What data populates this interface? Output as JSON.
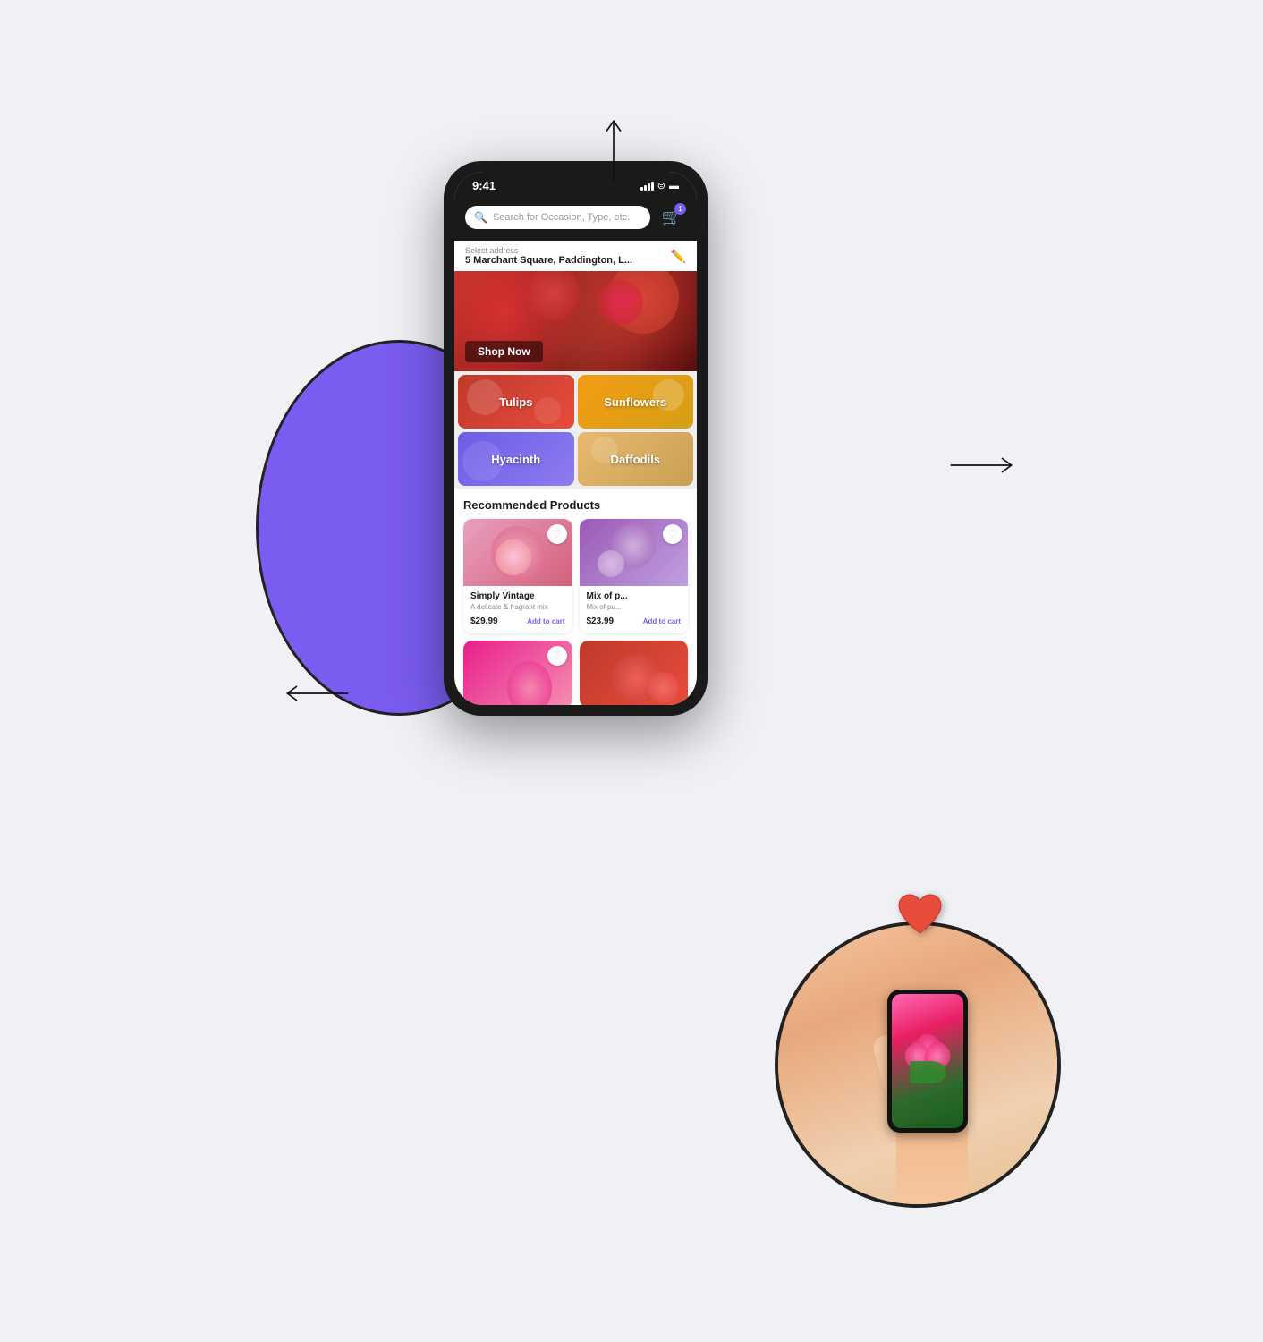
{
  "scene": {
    "background_color": "#f0f0f5"
  },
  "status_bar": {
    "time": "9:41",
    "cart_badge": "1"
  },
  "search": {
    "placeholder": "Search for Occasion, Type, etc."
  },
  "address": {
    "label": "Select address",
    "value": "5 Marchant Square, Paddington, L..."
  },
  "hero": {
    "button_label": "Shop Now"
  },
  "categories": [
    {
      "id": "tulips",
      "label": "Tulips",
      "class": "tulips"
    },
    {
      "id": "sunflowers",
      "label": "Sunflowers",
      "class": "sunflowers"
    },
    {
      "id": "hyacinth",
      "label": "Hyacinth",
      "class": "hyacinth"
    },
    {
      "id": "daffodils",
      "label": "Daffodils",
      "class": "daffodils"
    }
  ],
  "recommended": {
    "section_title": "Recommended Products",
    "products": [
      {
        "id": "p1",
        "name": "Simply Vintage",
        "description": "A delicate & fragrant mix",
        "price": "$29.99",
        "add_to_cart": "Add to cart",
        "image_class": "pink-flowers"
      },
      {
        "id": "p2",
        "name": "Mix of p...",
        "description": "Mix of pu...",
        "price": "$23.99",
        "add_to_cart": "Add to cart",
        "image_class": "purple-flowers"
      },
      {
        "id": "p3",
        "name": "",
        "description": "",
        "price": "",
        "add_to_cart": "",
        "image_class": "pink-tulips"
      },
      {
        "id": "p4",
        "name": "",
        "description": "",
        "price": "",
        "add_to_cart": "",
        "image_class": "red-roses"
      }
    ]
  },
  "arrows": {
    "up": "↑",
    "right": "→",
    "left": "←"
  }
}
